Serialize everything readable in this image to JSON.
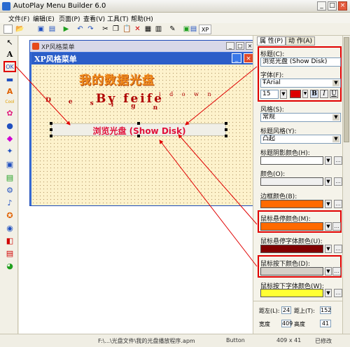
{
  "window": {
    "title": "AutoPlay Menu Builder 6.0",
    "min": "_",
    "max": "□",
    "close": "×"
  },
  "menubar": [
    "文件(F)",
    "编辑(E)",
    "页面(P)",
    "查看(V)",
    "工具(T)",
    "帮助(H)"
  ],
  "toolbar": {
    "icons": [
      "new-icon",
      "open-icon",
      "save-icon",
      "save-all-icon",
      "run-icon",
      "undo-icon",
      "redo-icon",
      "cut-icon",
      "copy-icon",
      "paste-icon",
      "delete-icon",
      "page-settings-icon",
      "preview-icon",
      "edit-icon",
      "build-icon",
      "image-icon",
      "export-icon"
    ],
    "xp_label": "XP"
  },
  "left_toolbar": {
    "icons": [
      "pointer-icon",
      "text-icon",
      "button-icon",
      "bar-icon",
      "fancy-text-icon",
      "cool-effect-icon",
      "image-icon",
      "flash-icon",
      "shape-icon",
      "plugin-icon",
      "photo-icon",
      "list-icon",
      "settings-icon",
      "music-icon",
      "link-icon",
      "app-icon",
      "pdf-icon",
      "doc-icon",
      "chat-icon"
    ]
  },
  "design_window": {
    "title": "XP风格菜单",
    "xp_menu_title": "XP风格菜单",
    "heading": "我的数据光盘",
    "design_text": "D e s i g n",
    "by_text": "By feife",
    "idown_text": "i d o w n",
    "button_label": "浏览光盘 (Show Disk)"
  },
  "properties": {
    "tabs": [
      "属 性(P)",
      "动 作(A)"
    ],
    "caption_label": "标题(C):",
    "caption_value": "浏览光盘 (Show Disk)",
    "font_label": "字体(F):",
    "font_value": "Arial",
    "font_size": "15",
    "bold": "B",
    "italic": "I",
    "underline": "U",
    "style_label": "风格(S):",
    "style_value": "常规",
    "caption_style_label": "标题风格(Y):",
    "caption_style_value": "凸起",
    "caption_shadow_label": "标题阴影颜色(H):",
    "color_label": "颜色(O):",
    "border_color_label": "边框颜色(B):",
    "hover_color_label": "鼠标悬停颜色(M):",
    "hover_font_color_label": "鼠标悬停字体颜色(U):",
    "press_color_label": "鼠标按下颜色(D):",
    "press_font_color_label": "鼠标按下字体颜色(W):",
    "left_label": "距左(L):",
    "left_value": "24",
    "top_label": "距上(T):",
    "top_value": "152",
    "width_label": "宽度",
    "width_value": "409",
    "height_label": "高度",
    "height_value": "41",
    "colors": {
      "font": "#dd0000",
      "caption_shadow": "#ffffff",
      "color": "#f0f0f0",
      "border": "#ff6a00",
      "hover": "#ff6a00",
      "hover_font": "#800000",
      "press": "#d4d0c8",
      "press_font": "#ffff33"
    }
  },
  "statusbar": {
    "path": "F:\\...\\光盘文件\\我的光盘播放程序.apm",
    "object": "Button",
    "size": "409 x 41",
    "state": "已修改"
  }
}
